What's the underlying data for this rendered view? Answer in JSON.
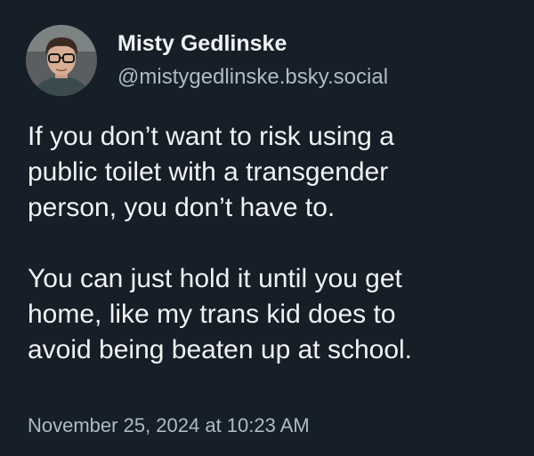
{
  "author": {
    "display_name": "Misty Gedlinske",
    "handle": "@mistygedlinske.bsky.social"
  },
  "post": {
    "paragraphs": [
      "If you don’t want to risk using a\npublic toilet with a transgender\nperson, you don’t have to.",
      "You can just hold it until you get\nhome, like my trans kid does to\navoid being beaten up at school."
    ],
    "timestamp": "November 25, 2024 at 10:23 AM"
  },
  "colors": {
    "background": "#161e27",
    "primary_text": "#f1f3f5",
    "secondary_text": "#aebbc9"
  }
}
